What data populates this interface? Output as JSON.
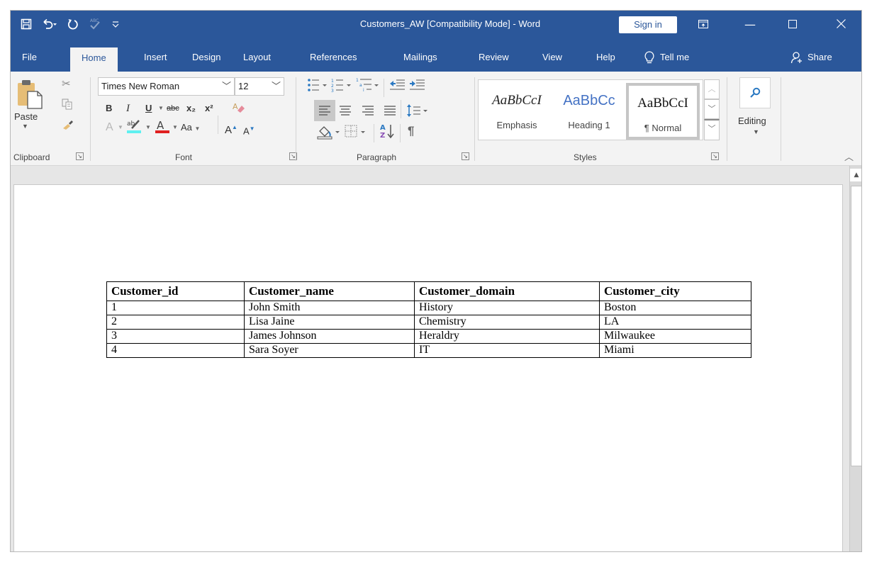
{
  "window": {
    "title": "Customers_AW [Compatibility Mode]  -  Word",
    "sign_in_label": "Sign in",
    "controls": {
      "ribbon_display": "ribbon-display-icon",
      "minimize": "—",
      "maximize": "☐",
      "close": "✕"
    }
  },
  "qat": {
    "save": "save-icon",
    "undo": "undo-icon",
    "redo": "redo-icon",
    "spelling": "spelling-icon",
    "customize": "customize-qat-icon"
  },
  "tabs": [
    {
      "label": "File"
    },
    {
      "label": "Home",
      "active": true
    },
    {
      "label": "Insert"
    },
    {
      "label": "Design"
    },
    {
      "label": "Layout"
    },
    {
      "label": "References"
    },
    {
      "label": "Mailings"
    },
    {
      "label": "Review"
    },
    {
      "label": "View"
    },
    {
      "label": "Help"
    },
    {
      "label": "Tell me"
    }
  ],
  "share_label": "Share",
  "ribbon": {
    "clipboard": {
      "label": "Clipboard",
      "paste_label": "Paste"
    },
    "font": {
      "label": "Font",
      "font_name": "Times New Roman",
      "font_size": "12",
      "bold": "B",
      "italic": "I",
      "underline": "U",
      "strikethrough": "abc",
      "subscript": "x₂",
      "superscript": "x²",
      "change_case": "Aa",
      "grow": "A",
      "shrink": "A",
      "highlight_color": "#5ff0f0",
      "font_color": "#e02020"
    },
    "paragraph": {
      "label": "Paragraph",
      "pilcrow": "¶"
    },
    "styles": {
      "label": "Styles",
      "items": [
        {
          "sample": "AaBbCcI",
          "name": "Emphasis"
        },
        {
          "sample": "AaBbCc",
          "name": "Heading 1"
        },
        {
          "sample": "AaBbCcI",
          "name": "¶ Normal",
          "selected": true
        }
      ]
    },
    "editing": {
      "label": "Editing"
    }
  },
  "document": {
    "table": {
      "headers": [
        "Customer_id",
        "Customer_name",
        "Customer_domain",
        "Customer_city"
      ],
      "rows": [
        [
          "1",
          "John Smith",
          "History",
          "Boston"
        ],
        [
          "2",
          "Lisa Jaine",
          "Chemistry",
          "LA"
        ],
        [
          "3",
          "James Johnson",
          "Heraldry",
          "Milwaukee"
        ],
        [
          "4",
          "Sara Soyer",
          "IT",
          "Miami"
        ]
      ]
    }
  },
  "colors": {
    "accent": "#2b579a",
    "ribbon_bg": "#f3f3f3",
    "heading_blue": "#4472c4"
  }
}
